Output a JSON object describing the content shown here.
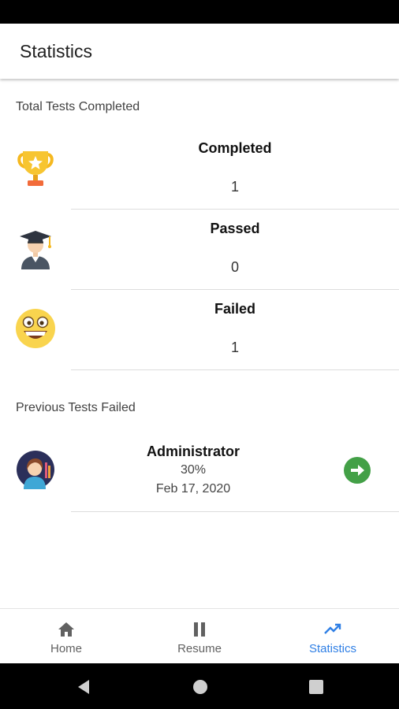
{
  "app_bar": {
    "title": "Statistics"
  },
  "summary": {
    "header": "Total Tests Completed",
    "items": [
      {
        "icon": "trophy-icon",
        "label": "Completed",
        "value": "1"
      },
      {
        "icon": "graduate-icon",
        "label": "Passed",
        "value": "0"
      },
      {
        "icon": "grinning-face-icon",
        "label": "Failed",
        "value": "1"
      }
    ]
  },
  "previous_failed": {
    "header": "Previous Tests Failed",
    "items": [
      {
        "icon": "user-avatar-icon",
        "name": "Administrator",
        "score": "30%",
        "date": "Feb 17, 2020",
        "action_icon": "arrow-right-circle-icon"
      }
    ]
  },
  "bottom_nav": {
    "items": [
      {
        "icon": "home-icon",
        "label": "Home",
        "active": false
      },
      {
        "icon": "pause-icon",
        "label": "Resume",
        "active": false
      },
      {
        "icon": "trending-up-icon",
        "label": "Statistics",
        "active": true
      }
    ]
  },
  "colors": {
    "accent": "#2f7fe5",
    "go_button": "#43a047",
    "divider": "#dddddd"
  }
}
